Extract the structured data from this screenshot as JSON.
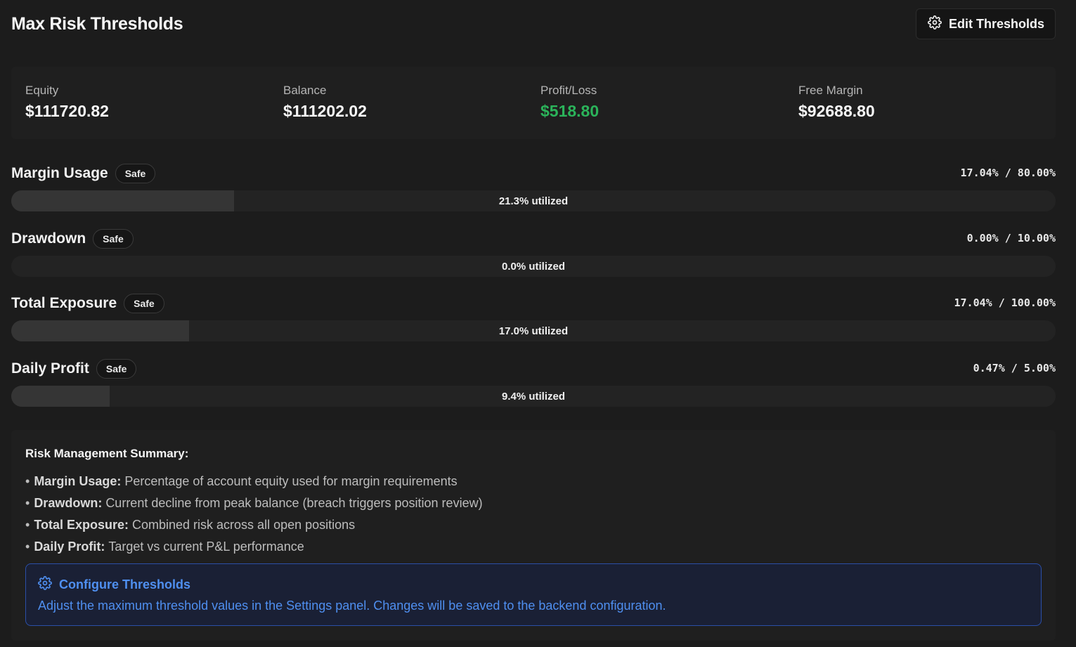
{
  "header": {
    "title": "Max Risk Thresholds",
    "edit_button_label": "Edit Thresholds",
    "edit_button_icon": "gear-icon"
  },
  "stats": [
    {
      "label": "Equity",
      "value": "$111720.82"
    },
    {
      "label": "Balance",
      "value": "$111202.02"
    },
    {
      "label": "Profit/Loss",
      "value": "$518.80",
      "color": "#2bb35a"
    },
    {
      "label": "Free Margin",
      "value": "$92688.80"
    }
  ],
  "metrics": [
    {
      "name": "Margin Usage",
      "status": "Safe",
      "values": "17.04% / 80.00%",
      "utilized_label": "21.3% utilized",
      "utilized_fraction": 0.213
    },
    {
      "name": "Drawdown",
      "status": "Safe",
      "values": "0.00% / 10.00%",
      "utilized_label": "0.0% utilized",
      "utilized_fraction": 0.0
    },
    {
      "name": "Total Exposure",
      "status": "Safe",
      "values": "17.04% / 100.00%",
      "utilized_label": "17.0% utilized",
      "utilized_fraction": 0.17
    },
    {
      "name": "Daily Profit",
      "status": "Safe",
      "values": "0.47% / 5.00%",
      "utilized_label": "9.4% utilized",
      "utilized_fraction": 0.094
    }
  ],
  "summary": {
    "title": "Risk Management Summary:",
    "items": [
      {
        "term": "Margin Usage:",
        "text": "Percentage of account equity used for margin requirements"
      },
      {
        "term": "Drawdown:",
        "text": "Current decline from peak balance (breach triggers position review)"
      },
      {
        "term": "Total Exposure:",
        "text": "Combined risk across all open positions"
      },
      {
        "term": "Daily Profit:",
        "text": "Target vs current P&L performance"
      }
    ],
    "info": {
      "icon": "gear-icon",
      "title": "Configure Thresholds",
      "text": "Adjust the maximum threshold values in the Settings panel. Changes will be saved to the backend configuration.",
      "accent_color": "#4f8ff0"
    }
  },
  "colors": {
    "background": "#1c1c1c",
    "positive": "#2bb35a",
    "info_border": "#2b4fa8"
  }
}
